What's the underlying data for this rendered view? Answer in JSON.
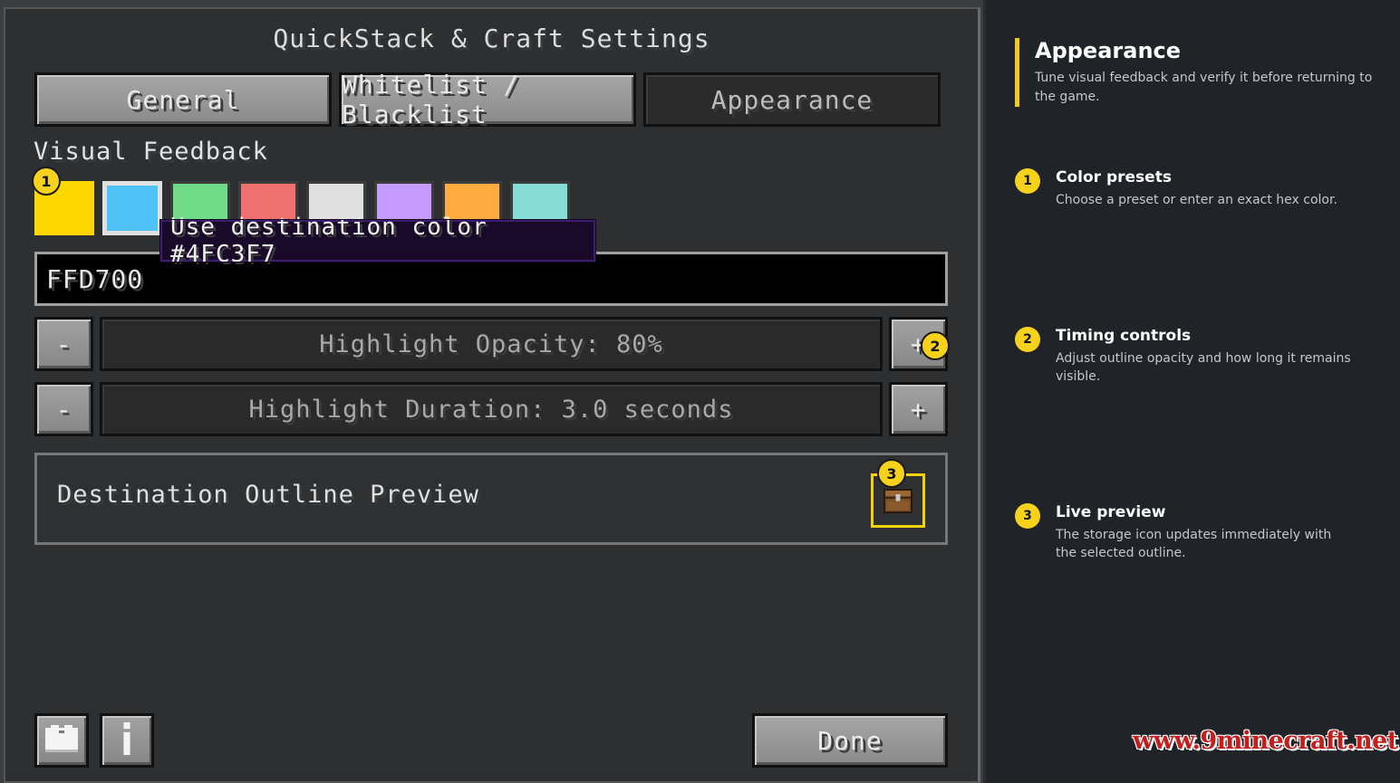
{
  "screen": {
    "title": "QuickStack & Craft Settings"
  },
  "tabs": [
    {
      "label": "General",
      "active": false
    },
    {
      "label": "Whitelist / Blacklist",
      "active": false
    },
    {
      "label": "Appearance",
      "active": true
    }
  ],
  "visual_feedback": {
    "label": "Visual Feedback",
    "swatches": [
      {
        "color": "#FFD700",
        "state": "selected"
      },
      {
        "color": "#4FC3F7",
        "state": "hover"
      },
      {
        "color": "#6FDB86",
        "state": "normal"
      },
      {
        "color": "#F07070",
        "state": "normal"
      },
      {
        "color": "#E0E0E0",
        "state": "normal"
      },
      {
        "color": "#C59BFF",
        "state": "normal"
      },
      {
        "color": "#FFAB40",
        "state": "normal"
      },
      {
        "color": "#86DCD6",
        "state": "normal"
      }
    ],
    "tooltip": "Use destination color #4FC3F7",
    "hex_value": "FFD700"
  },
  "opacity": {
    "minus": "-",
    "label": "Highlight Opacity: 80%",
    "plus": "+"
  },
  "duration": {
    "minus": "-",
    "label": "Highlight Duration: 3.0 seconds",
    "plus": "+"
  },
  "preview": {
    "label": "Destination Outline Preview",
    "icon": "chest-icon",
    "outline_color": "#F2D10A"
  },
  "footer": {
    "left_buttons": [
      "book-icon",
      "info-icon"
    ],
    "done": "Done"
  },
  "markers": [
    "1",
    "2",
    "3"
  ],
  "side": {
    "title": "Appearance",
    "subtitle": "Tune visual feedback and verify it before returning to the game.",
    "steps": [
      {
        "num": "1",
        "title": "Color presets",
        "desc": "Choose a preset or enter an exact hex color."
      },
      {
        "num": "2",
        "title": "Timing controls",
        "desc": "Adjust outline opacity and how long it remains visible."
      },
      {
        "num": "3",
        "title": "Live preview",
        "desc": "The storage icon updates immediately with the selected outline."
      }
    ]
  },
  "watermark": "www.9minecraft.net",
  "colors": {
    "accent": "#F6D21C",
    "tooltip_border": "#3E1E6E"
  }
}
